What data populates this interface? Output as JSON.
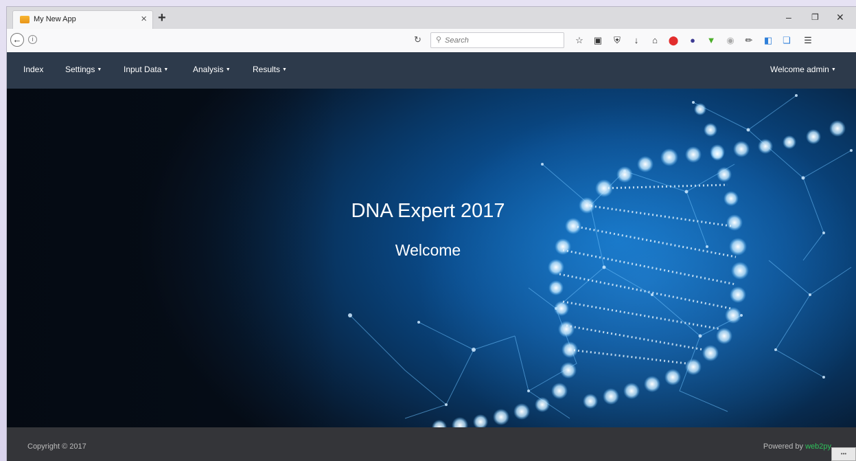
{
  "browser": {
    "tab_title": "My New App",
    "tab_close": "×",
    "new_tab": "+",
    "window_controls": {
      "minimize": "–",
      "restore": "❐",
      "close": "✕"
    },
    "search_placeholder": "Search"
  },
  "nav": {
    "items": [
      {
        "label": "Index",
        "dropdown": false
      },
      {
        "label": "Settings",
        "dropdown": true
      },
      {
        "label": "Input Data",
        "dropdown": true
      },
      {
        "label": "Analysis",
        "dropdown": true
      },
      {
        "label": "Results",
        "dropdown": true
      }
    ],
    "user_label": "Welcome admin"
  },
  "hero": {
    "title": "DNA Expert 2017",
    "subtitle": "Welcome"
  },
  "footer": {
    "copyright": "Copyright © 2017",
    "powered_prefix": "Powered by ",
    "powered_link": "web2py"
  },
  "colors": {
    "navbar": "#2d3a4b",
    "footer": "#343539",
    "link_green": "#2ec05a",
    "hero_blue": "#0a4d8e"
  },
  "icons": [
    "back-arrow-icon",
    "info-icon",
    "reload-icon",
    "search-icon",
    "bookmark-star-icon",
    "reading-list-icon",
    "pocket-icon",
    "download-icon",
    "home-icon",
    "adblock-icon",
    "extension-circle-icon",
    "extension-green-icon",
    "extension-gray-icon",
    "eyedropper-icon",
    "screenshot-icon",
    "extension-puzzle-icon",
    "hamburger-menu-icon"
  ]
}
